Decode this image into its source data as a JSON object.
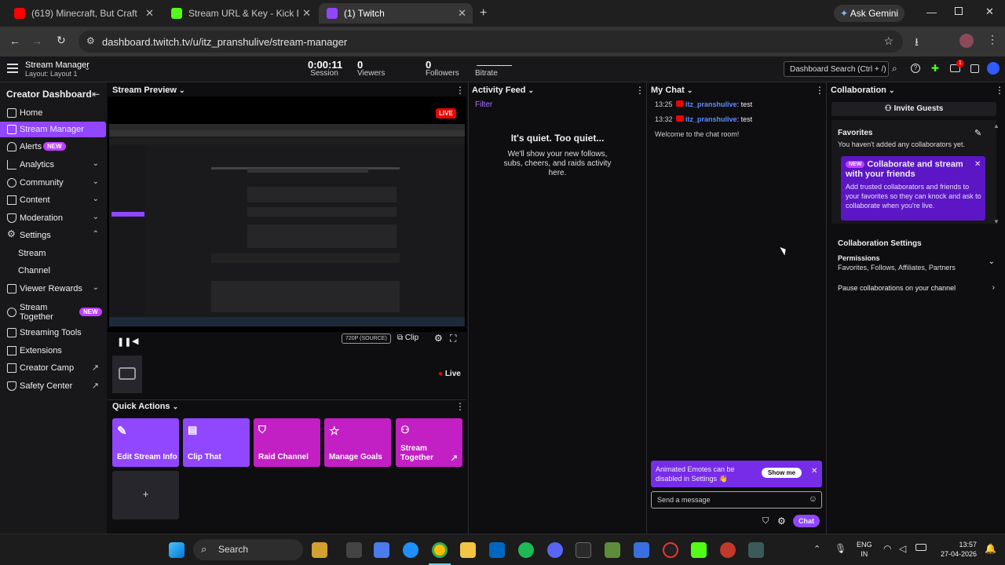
{
  "browser": {
    "tabs": [
      {
        "title": "(619) Minecraft, But Crafts Are R",
        "color": "#ff0000"
      },
      {
        "title": "Stream URL & Key - Kick Dashb",
        "color": "#53fc18"
      },
      {
        "title": "(1) Twitch",
        "color": "#9146ff"
      }
    ],
    "ask_gemini": "Ask Gemini",
    "url": "dashboard.twitch.tv/u/itz_pranshulive/stream-manager"
  },
  "topbar": {
    "title": "Stream Manager",
    "subtitle": "Layout: Layout 1",
    "session_value": "0:00:11",
    "session_label": "Session",
    "viewers_value": "0",
    "viewers_label": "Viewers",
    "followers_value": "0",
    "followers_label": "Followers",
    "bitrate_label": "Bitrate",
    "search_placeholder": "Dashboard Search (Ctrl + /)",
    "notif_count": "1"
  },
  "sidebar": {
    "title": "Creator Dashboard",
    "items": [
      {
        "label": "Home"
      },
      {
        "label": "Stream Manager"
      },
      {
        "label": "Alerts",
        "badge": "NEW"
      },
      {
        "label": "Analytics"
      },
      {
        "label": "Community"
      },
      {
        "label": "Content"
      },
      {
        "label": "Moderation"
      },
      {
        "label": "Settings"
      },
      {
        "label": "Stream"
      },
      {
        "label": "Channel"
      },
      {
        "label": "Viewer Rewards"
      },
      {
        "label": "Stream Together",
        "badge": "NEW"
      },
      {
        "label": "Streaming Tools"
      },
      {
        "label": "Extensions"
      },
      {
        "label": "Creator Camp"
      },
      {
        "label": "Safety Center"
      }
    ]
  },
  "preview": {
    "header": "Stream Preview",
    "live_badge": "LIVE",
    "quality": "720P (SOURCE)",
    "clip_label": "Clip",
    "live_label": "Live"
  },
  "quick_actions": {
    "header": "Quick Actions",
    "items": [
      {
        "label": "Edit Stream Info",
        "color": "#9146ff"
      },
      {
        "label": "Clip That",
        "color": "#9146ff"
      },
      {
        "label": "Raid Channel",
        "color": "#c21fc4"
      },
      {
        "label": "Manage Goals",
        "color": "#c21fc4"
      },
      {
        "label": "Stream Together",
        "color": "#c21fc4"
      }
    ],
    "add_label": "+"
  },
  "activity": {
    "header": "Activity Feed",
    "filter": "Filter",
    "empty_title": "It's quiet. Too quiet...",
    "empty_body": "We'll show your new follows, subs, cheers, and raids activity here."
  },
  "chat": {
    "header": "My Chat",
    "messages": [
      {
        "time": "13:25",
        "user": "itz_pranshulive",
        "text": ": test"
      },
      {
        "time": "13:32",
        "user": "itz_pranshulive",
        "text": ": test"
      }
    ],
    "welcome": "Welcome to the chat room!",
    "toast_text": "Animated Emotes can be disabled in Settings 👋",
    "toast_button": "Show me",
    "input_placeholder": "Send a message",
    "send_label": "Chat"
  },
  "collab": {
    "header": "Collaboration",
    "invite": "Invite Guests",
    "favorites_title": "Favorites",
    "favorites_empty": "You haven't added any collaborators yet.",
    "promo_badge": "NEW",
    "promo_title": "Collaborate and stream with your friends",
    "promo_body": "Add trusted collaborators and friends to your favorites so they can knock and ask to collaborate when you're live.",
    "settings_title": "Collaboration Settings",
    "permissions_title": "Permissions",
    "permissions_value": "Favorites, Follows, Affiliates, Partners",
    "pause_label": "Pause collaborations on your channel"
  },
  "taskbar": {
    "search": "Search",
    "lang_top": "ENG",
    "lang_bottom": "IN",
    "time": "13:57",
    "date": "27-04-2026"
  }
}
